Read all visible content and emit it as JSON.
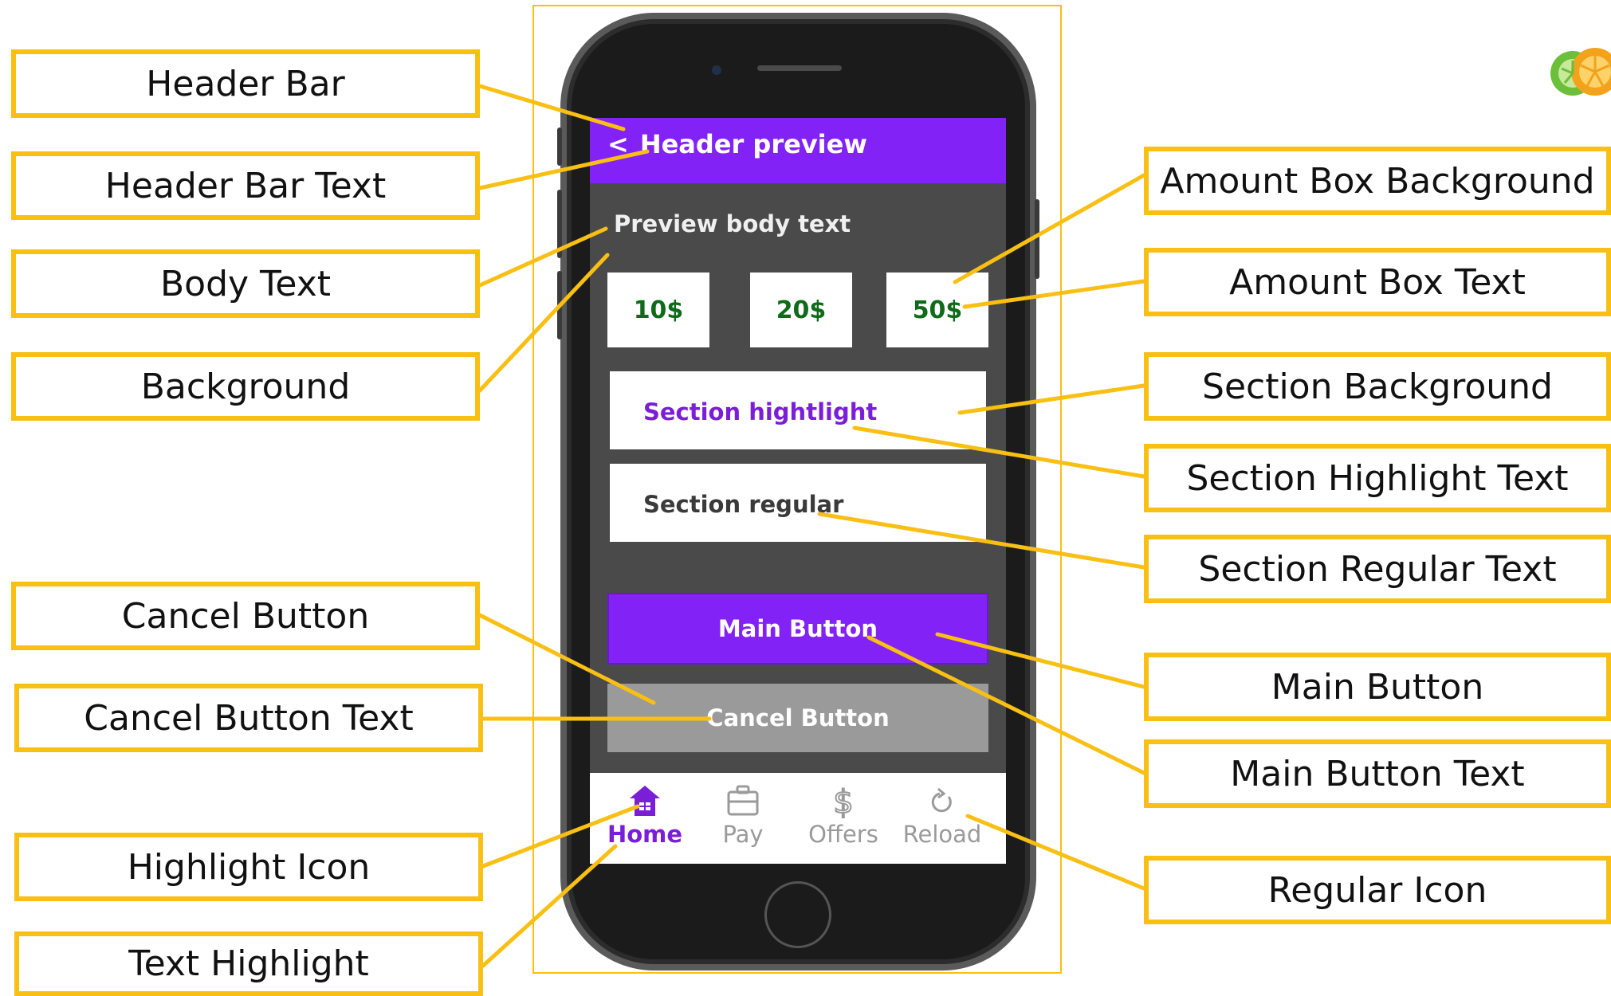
{
  "labels": {
    "left": [
      "Header Bar",
      "Header Bar Text",
      "Body Text",
      "Background",
      "Cancel Button",
      "Cancel Button Text",
      "Highlight Icon",
      "Text Highlight"
    ],
    "right": [
      "Amount Box Background",
      "Amount Box Text",
      "Section Background",
      "Section Highlight Text",
      "Section Regular Text",
      "Main Button",
      "Main Button Text",
      "Regular Icon"
    ]
  },
  "phone": {
    "header": {
      "back_glyph": "<",
      "title": "Header preview"
    },
    "body_text": "Preview body text",
    "amounts": [
      "10$",
      "20$",
      "50$"
    ],
    "section_highlight": "Section hightlight",
    "section_regular": "Section regular",
    "main_button": "Main Button",
    "cancel_button": "Cancel Button",
    "tabs": [
      {
        "label": "Home",
        "icon": "home-icon",
        "active": true
      },
      {
        "label": "Pay",
        "icon": "briefcase-icon",
        "active": false
      },
      {
        "label": "Offers",
        "icon": "dollar-icon",
        "active": false
      },
      {
        "label": "Reload",
        "icon": "reload-icon",
        "active": false
      }
    ]
  },
  "colors": {
    "accent": "#f9bf13",
    "primary": "#8222f6",
    "screen_background": "#4a4a4a",
    "amount_text": "#0f6a1a",
    "cancel": "#9a9a9a",
    "inactive_tab": "#9a9a9a"
  }
}
